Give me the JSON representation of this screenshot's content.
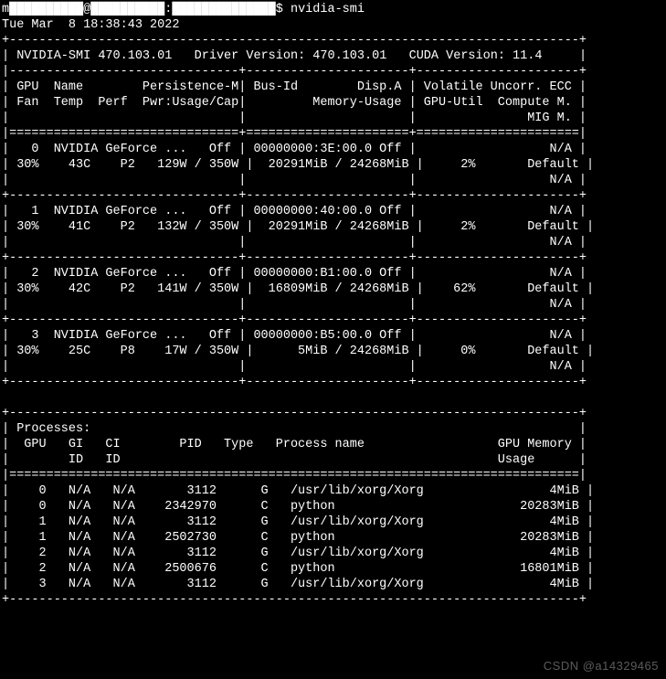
{
  "prompt": {
    "user_host_obscured": "m██████████@██████████:██████████████",
    "symbol": "$",
    "command": "nvidia-smi"
  },
  "timestamp_line": "Tue Mar  8 18:38:43 2022",
  "header": {
    "smi": "NVIDIA-SMI 470.103.01",
    "driver": "Driver Version: 470.103.01",
    "cuda": "CUDA Version: 11.4"
  },
  "column_headers": {
    "l1": "| GPU  Name        Persistence-M| Bus-Id        Disp.A | Volatile Uncorr. ECC |",
    "l2": "| Fan  Temp  Perf  Pwr:Usage/Cap|         Memory-Usage | GPU-Util  Compute M. |",
    "l3": "|                               |                      |               MIG M. |"
  },
  "gpus": [
    {
      "idx": "0",
      "name": "NVIDIA GeForce ...",
      "persist": "Off",
      "bus": "00000000:3E:00.0",
      "disp": "Off",
      "ecc": "N/A",
      "fan": "30%",
      "temp": "43C",
      "perf": "P2",
      "pwr": "129W / 350W",
      "mem": "20291MiB / 24268MiB",
      "util": "2%",
      "compute": "Default",
      "mig": "N/A"
    },
    {
      "idx": "1",
      "name": "NVIDIA GeForce ...",
      "persist": "Off",
      "bus": "00000000:40:00.0",
      "disp": "Off",
      "ecc": "N/A",
      "fan": "30%",
      "temp": "41C",
      "perf": "P2",
      "pwr": "132W / 350W",
      "mem": "20291MiB / 24268MiB",
      "util": "2%",
      "compute": "Default",
      "mig": "N/A"
    },
    {
      "idx": "2",
      "name": "NVIDIA GeForce ...",
      "persist": "Off",
      "bus": "00000000:B1:00.0",
      "disp": "Off",
      "ecc": "N/A",
      "fan": "30%",
      "temp": "42C",
      "perf": "P2",
      "pwr": "141W / 350W",
      "mem": "16809MiB / 24268MiB",
      "util": "62%",
      "compute": "Default",
      "mig": "N/A"
    },
    {
      "idx": "3",
      "name": "NVIDIA GeForce ...",
      "persist": "Off",
      "bus": "00000000:B5:00.0",
      "disp": "Off",
      "ecc": "N/A",
      "fan": "30%",
      "temp": "25C",
      "perf": "P8",
      "pwr": "17W / 350W",
      "mem": "5MiB / 24268MiB",
      "util": "0%",
      "compute": "Default",
      "mig": "N/A"
    }
  ],
  "proc_header": {
    "title": "Processes:",
    "l1": "|  GPU   GI   CI        PID   Type   Process name                  GPU Memory |",
    "l2": "|        ID   ID                                                   Usage      |"
  },
  "processes": [
    {
      "gpu": "0",
      "gi": "N/A",
      "ci": "N/A",
      "pid": "3112",
      "type": "G",
      "name": "/usr/lib/xorg/Xorg",
      "mem": "4MiB"
    },
    {
      "gpu": "0",
      "gi": "N/A",
      "ci": "N/A",
      "pid": "2342970",
      "type": "C",
      "name": "python",
      "mem": "20283MiB"
    },
    {
      "gpu": "1",
      "gi": "N/A",
      "ci": "N/A",
      "pid": "3112",
      "type": "G",
      "name": "/usr/lib/xorg/Xorg",
      "mem": "4MiB"
    },
    {
      "gpu": "1",
      "gi": "N/A",
      "ci": "N/A",
      "pid": "2502730",
      "type": "C",
      "name": "python",
      "mem": "20283MiB"
    },
    {
      "gpu": "2",
      "gi": "N/A",
      "ci": "N/A",
      "pid": "3112",
      "type": "G",
      "name": "/usr/lib/xorg/Xorg",
      "mem": "4MiB"
    },
    {
      "gpu": "2",
      "gi": "N/A",
      "ci": "N/A",
      "pid": "2500676",
      "type": "C",
      "name": "python",
      "mem": "16801MiB"
    },
    {
      "gpu": "3",
      "gi": "N/A",
      "ci": "N/A",
      "pid": "3112",
      "type": "G",
      "name": "/usr/lib/xorg/Xorg",
      "mem": "4MiB"
    }
  ],
  "watermark": "CSDN @a14329465"
}
